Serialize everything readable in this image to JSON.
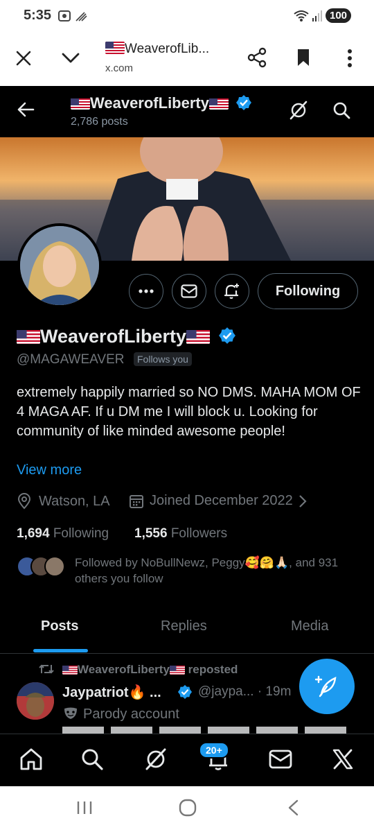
{
  "status_bar": {
    "time": "5:35",
    "battery": "100"
  },
  "browser": {
    "page_title": "WeaverofLib...",
    "domain": "x.com",
    "icons": [
      "close-icon",
      "chevron-down-icon",
      "share-icon",
      "bookmark-icon",
      "more-vertical-icon"
    ]
  },
  "header": {
    "name": "WeaverofLiberty",
    "posts_count": "2,786 posts"
  },
  "profile": {
    "display_name": "WeaverofLiberty",
    "handle": "@MAGAWEAVER",
    "follows_you": "Follows you",
    "following_button": "Following",
    "bio": "extremely happily married so NO DMS.  MAHA MOM OF 4  MAGA AF. If u DM me I will block u. Looking for community of like minded awesome people!",
    "view_more": "View more",
    "location": "Watson, LA",
    "joined": "Joined December 2022",
    "following_count": "1,694",
    "following_label": "Following",
    "followers_count": "1,556",
    "followers_label": "Followers",
    "followed_by": "Followed by NoBullNewz, Peggy🥰🤗🙏🏻, and 931 others you follow"
  },
  "tabs": [
    {
      "label": "Posts",
      "active": true
    },
    {
      "label": "Replies",
      "active": false
    },
    {
      "label": "Media",
      "active": false
    }
  ],
  "post": {
    "reposter": "WeaverofLiberty",
    "repost_suffix": "reposted",
    "author": "Jaypatriot🔥 ...",
    "handle": "@jaypa... · 19m",
    "label": "Parody account"
  },
  "bottom_nav": {
    "notifications_badge": "20+"
  },
  "colors": {
    "accent": "#1d9bf0",
    "background": "#000000",
    "text": "#e7e9ea",
    "muted": "#71767b"
  }
}
